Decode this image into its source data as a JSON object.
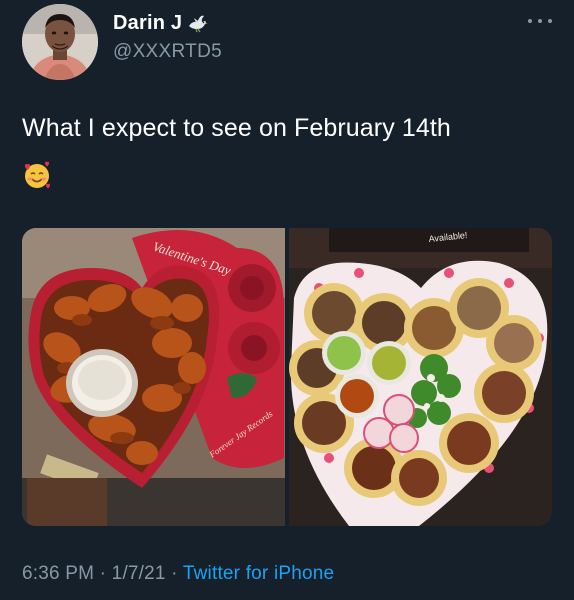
{
  "author": {
    "display_name": "Darin J",
    "handle": "@XXXRTD5",
    "avatar_icon": "person-avatar",
    "badge_icon": "dove-emoji"
  },
  "tweet": {
    "text": "What I expect to see on February 14th",
    "emoji_icon": "smiling-face-with-hearts-emoji"
  },
  "media": {
    "photo_left": {
      "box_text": "Valentine's Day",
      "box_signature": "Forever Jay Records"
    },
    "photo_right": {
      "banner_text": "Available!"
    }
  },
  "meta": {
    "time": "6:36 PM",
    "separator1": " · ",
    "date": "1/7/21",
    "separator2": " · ",
    "source": "Twitter for iPhone"
  },
  "colors": {
    "background": "#15202b",
    "secondary_text": "#8899a6",
    "link": "#1da1f2"
  }
}
